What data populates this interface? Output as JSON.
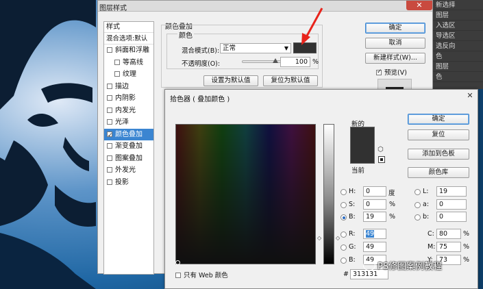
{
  "background": {
    "right_menu": [
      "新选择",
      "图层",
      "入选区",
      "导选区",
      "选反向",
      "色",
      "图层",
      "色"
    ]
  },
  "layer_style": {
    "title": "图层样式",
    "styles_header": "样式",
    "blend_options": "混合选项:默认",
    "effects": [
      {
        "label": "斜面和浮雕",
        "checked": false,
        "sub": false,
        "selected": false
      },
      {
        "label": "等高线",
        "checked": false,
        "sub": true,
        "selected": false
      },
      {
        "label": "纹理",
        "checked": false,
        "sub": true,
        "selected": false
      },
      {
        "label": "描边",
        "checked": false,
        "sub": false,
        "selected": false
      },
      {
        "label": "内阴影",
        "checked": false,
        "sub": false,
        "selected": false
      },
      {
        "label": "内发光",
        "checked": false,
        "sub": false,
        "selected": false
      },
      {
        "label": "光泽",
        "checked": false,
        "sub": false,
        "selected": false
      },
      {
        "label": "颜色叠加",
        "checked": true,
        "sub": false,
        "selected": true
      },
      {
        "label": "渐变叠加",
        "checked": false,
        "sub": false,
        "selected": false
      },
      {
        "label": "图案叠加",
        "checked": false,
        "sub": false,
        "selected": false
      },
      {
        "label": "外发光",
        "checked": false,
        "sub": false,
        "selected": false
      },
      {
        "label": "投影",
        "checked": false,
        "sub": false,
        "selected": false
      }
    ],
    "group_title": "颜色叠加",
    "sub_title": "颜色",
    "blend_mode_label": "混合模式(B):",
    "blend_mode_value": "正常",
    "opacity_label": "不透明度(O):",
    "opacity_value": "100",
    "opacity_unit": "%",
    "overlay_color": "#313131",
    "set_default": "设置为默认值",
    "reset_default": "复位为默认值",
    "ok": "确定",
    "cancel": "取消",
    "new_style": "新建样式(W)...",
    "preview_label": "预览(V)",
    "preview_checked": true
  },
  "picker": {
    "title": "拾色器 ( 叠加颜色 )",
    "ok": "确定",
    "reset": "复位",
    "add_to_swatches": "添加到色板",
    "color_libraries": "颜色库",
    "new_label": "新的",
    "current_label": "当前",
    "new_color": "#313131",
    "current_color": "#313131",
    "hsb": {
      "h": {
        "label": "H:",
        "value": "0",
        "unit": "度"
      },
      "s": {
        "label": "S:",
        "value": "0",
        "unit": "%"
      },
      "b": {
        "label": "B:",
        "value": "19",
        "unit": "%"
      }
    },
    "rgb": {
      "r": {
        "label": "R:",
        "value": "49"
      },
      "g": {
        "label": "G:",
        "value": "49"
      },
      "b": {
        "label": "B:",
        "value": "49"
      }
    },
    "lab": {
      "l": {
        "label": "L:",
        "value": "19"
      },
      "a": {
        "label": "a:",
        "value": "0"
      },
      "b": {
        "label": "b:",
        "value": "0"
      }
    },
    "cmyk": {
      "c": {
        "label": "C:",
        "value": "80",
        "unit": "%"
      },
      "m": {
        "label": "M:",
        "value": "75",
        "unit": "%"
      },
      "y": {
        "label": "Y:",
        "value": "73",
        "unit": "%"
      }
    },
    "web_only": "只有 Web 颜色",
    "hash": "#",
    "hex": "313131"
  },
  "watermark": "PS修图案例教程"
}
